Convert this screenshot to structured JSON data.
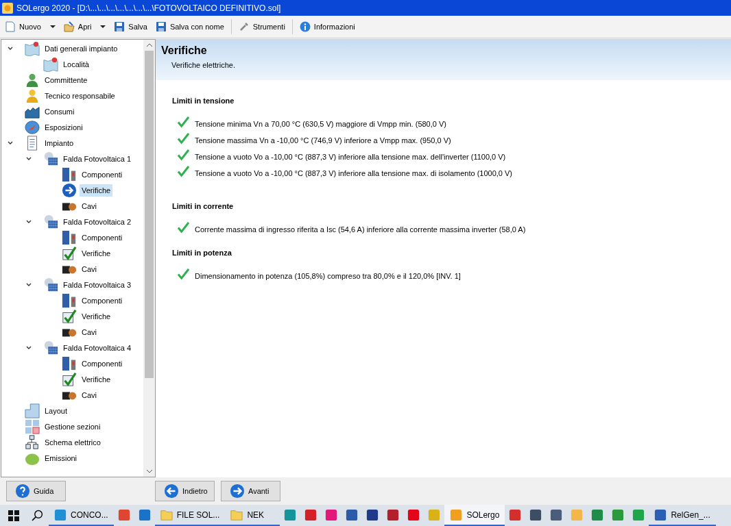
{
  "window": {
    "title": "SOLergo 2020 - [D:\\...\\...\\...\\...\\...\\...\\...\\FOTOVOLTAICO DEFINITIVO.sol]"
  },
  "toolbar": [
    {
      "label": "Nuovo",
      "kind": "new",
      "dropdown": true
    },
    {
      "label": "Apri",
      "kind": "open",
      "dropdown": true
    },
    {
      "label": "Salva",
      "kind": "save",
      "dropdown": false
    },
    {
      "label": "Salva con nome",
      "kind": "save",
      "dropdown": false
    },
    {
      "kind": "separator"
    },
    {
      "label": "Strumenti",
      "kind": "tools",
      "dropdown": false
    },
    {
      "kind": "separator"
    },
    {
      "label": "Informazioni",
      "kind": "info",
      "dropdown": false
    }
  ],
  "tree": [
    {
      "label": "Dati generali impianto",
      "kind": "map",
      "selected": false,
      "expanded": true,
      "children": [
        {
          "label": "Località",
          "kind": "map",
          "selected": false
        }
      ]
    },
    {
      "label": "Committente",
      "kind": "client",
      "selected": false
    },
    {
      "label": "Tecnico responsabile",
      "kind": "technician",
      "selected": false
    },
    {
      "label": "Consumi",
      "kind": "chart",
      "selected": false
    },
    {
      "label": "Esposizioni",
      "kind": "compass",
      "selected": false
    },
    {
      "label": "Impianto",
      "kind": "document",
      "selected": false,
      "expanded": true,
      "children": [
        {
          "label": "Falda Fotovoltaica 1",
          "kind": "array",
          "selected": false,
          "expanded": true,
          "children": [
            {
              "label": "Componenti",
              "kind": "components",
              "selected": false
            },
            {
              "label": "Verifiche",
              "kind": "check",
              "selected": true
            },
            {
              "label": "Cavi",
              "kind": "cable",
              "selected": false
            }
          ]
        },
        {
          "label": "Falda Fotovoltaica 2",
          "kind": "array",
          "selected": false,
          "expanded": true,
          "children": [
            {
              "label": "Componenti",
              "kind": "components",
              "selected": false
            },
            {
              "label": "Verifiche",
              "kind": "check",
              "selected": false
            },
            {
              "label": "Cavi",
              "kind": "cable",
              "selected": false
            }
          ]
        },
        {
          "label": "Falda Fotovoltaica 3",
          "kind": "array",
          "selected": false,
          "expanded": true,
          "children": [
            {
              "label": "Componenti",
              "kind": "components",
              "selected": false
            },
            {
              "label": "Verifiche",
              "kind": "check",
              "selected": false
            },
            {
              "label": "Cavi",
              "kind": "cable",
              "selected": false
            }
          ]
        },
        {
          "label": "Falda Fotovoltaica 4",
          "kind": "array",
          "selected": false,
          "expanded": true,
          "children": [
            {
              "label": "Componenti",
              "kind": "components",
              "selected": false
            },
            {
              "label": "Verifiche",
              "kind": "check",
              "selected": false
            },
            {
              "label": "Cavi",
              "kind": "cable",
              "selected": false
            }
          ]
        }
      ]
    },
    {
      "label": "Layout",
      "kind": "layout",
      "selected": false
    },
    {
      "label": "Gestione sezioni",
      "kind": "sections",
      "selected": false
    },
    {
      "label": "Schema elettrico",
      "kind": "schema",
      "selected": false
    },
    {
      "label": "Emissioni",
      "kind": "leaf",
      "selected": false
    }
  ],
  "header": {
    "title": "Verifiche",
    "subtitle": "Verifiche elettriche."
  },
  "sections": [
    {
      "title": "Limiti in tensione",
      "checks": [
        {
          "text": "Tensione minima Vn a 70,00 °C (630,5 V) maggiore di Vmpp min. (580,0 V)",
          "passed": true
        },
        {
          "text": "Tensione massima Vn a -10,00 °C (746,9 V) inferiore a Vmpp max. (950,0 V)",
          "passed": true
        },
        {
          "text": "Tensione a vuoto Vo a -10,00 °C (887,3 V) inferiore alla tensione max. dell'inverter (1100,0 V)",
          "passed": true
        },
        {
          "text": "Tensione a vuoto Vo a -10,00 °C (887,3 V) inferiore alla tensione max. di isolamento (1000,0 V)",
          "passed": true
        }
      ]
    },
    {
      "title": "Limiti in corrente",
      "checks": [
        {
          "text": "Corrente massima di ingresso riferita a Isc (54,6 A) inferiore alla corrente massima inverter (58,0 A)",
          "passed": true
        }
      ]
    },
    {
      "title": "Limiti in potenza",
      "checks": [
        {
          "text": "Dimensionamento in potenza (105,8%) compreso tra 80,0% e il 120,0%  [INV. 1]",
          "passed": true
        }
      ]
    }
  ],
  "buttons": [
    {
      "label": "Guida",
      "kind": "help"
    },
    {
      "label": "Indietro",
      "kind": "back"
    },
    {
      "label": "Avanti",
      "kind": "next"
    }
  ],
  "taskbar": [
    {
      "kind": "start"
    },
    {
      "kind": "search"
    },
    {
      "kind": "edge",
      "label": "CONCO...",
      "running": true,
      "selected": false
    },
    {
      "kind": "chrome",
      "running": false,
      "selected": false
    },
    {
      "kind": "box",
      "running": false,
      "selected": false
    },
    {
      "kind": "folder",
      "label": "FILE SOL...",
      "running": true,
      "selected": false
    },
    {
      "kind": "folder",
      "label": "NEK",
      "running": true,
      "selected": false
    },
    {
      "kind": "arduino",
      "running": false,
      "selected": false
    },
    {
      "kind": "autocad",
      "running": false,
      "selected": false
    },
    {
      "kind": "pink",
      "running": false,
      "selected": false
    },
    {
      "kind": "dev",
      "running": false,
      "selected": false
    },
    {
      "kind": "c",
      "running": false,
      "selected": false
    },
    {
      "kind": "tool",
      "running": false,
      "selected": false
    },
    {
      "kind": "abb",
      "running": false,
      "selected": false
    },
    {
      "kind": "warn",
      "running": false,
      "selected": false
    },
    {
      "kind": "sun",
      "label": "SOLergo",
      "running": true,
      "selected": true
    },
    {
      "kind": "popcorn",
      "running": false,
      "selected": false
    },
    {
      "kind": "logo",
      "running": false,
      "selected": false
    },
    {
      "kind": "tia",
      "running": false,
      "selected": false
    },
    {
      "kind": "cloud",
      "running": false,
      "selected": false
    },
    {
      "kind": "excel",
      "running": false,
      "selected": false
    },
    {
      "kind": "info",
      "running": false,
      "selected": false
    },
    {
      "kind": "green",
      "running": false,
      "selected": false
    },
    {
      "kind": "word",
      "label": "RelGen_...",
      "running": true,
      "selected": false
    }
  ]
}
